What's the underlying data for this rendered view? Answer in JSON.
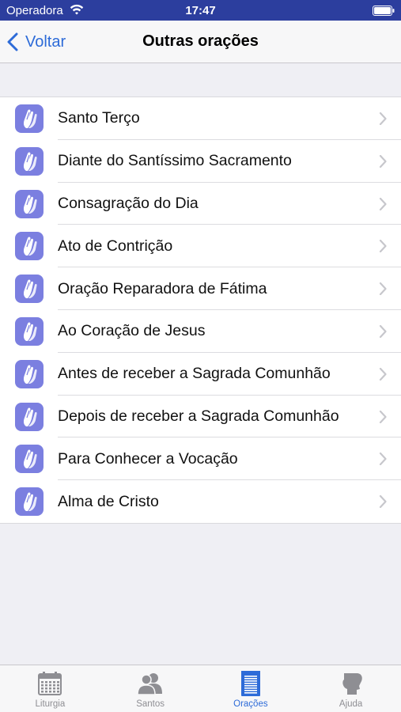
{
  "status_bar": {
    "carrier": "Operadora",
    "time": "17:47"
  },
  "nav": {
    "back_label": "Voltar",
    "title": "Outras orações"
  },
  "prayers": [
    {
      "label": "Santo Terço",
      "icon": "praying-hands-icon"
    },
    {
      "label": "Diante do Santíssimo Sacramento",
      "icon": "praying-hands-icon"
    },
    {
      "label": "Consagração do Dia",
      "icon": "praying-hands-icon"
    },
    {
      "label": "Ato de Contrição",
      "icon": "praying-hands-icon"
    },
    {
      "label": "Oração Reparadora de Fátima",
      "icon": "praying-hands-icon"
    },
    {
      "label": "Ao Coração de Jesus",
      "icon": "praying-hands-icon"
    },
    {
      "label": "Antes de receber a Sagrada Comunhão",
      "icon": "praying-hands-icon"
    },
    {
      "label": "Depois de receber a Sagrada Comunhão",
      "icon": "praying-hands-icon"
    },
    {
      "label": "Para Conhecer a Vocação",
      "icon": "praying-hands-icon"
    },
    {
      "label": "Alma de Cristo",
      "icon": "praying-hands-icon"
    }
  ],
  "tabs": [
    {
      "label": "Liturgia",
      "icon": "calendar-icon",
      "active": false
    },
    {
      "label": "Santos",
      "icon": "people-icon",
      "active": false
    },
    {
      "label": "Orações",
      "icon": "notepad-icon",
      "active": true
    },
    {
      "label": "Ajuda",
      "icon": "help-profile-icon",
      "active": false
    }
  ],
  "colors": {
    "status_bar": "#2c3e9e",
    "accent": "#2d6bd8",
    "icon_bg": "#7b7fe0",
    "background": "#efeff4"
  }
}
